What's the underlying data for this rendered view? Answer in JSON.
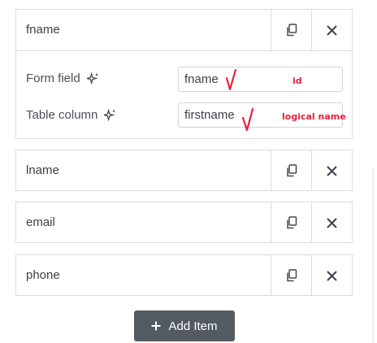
{
  "items": [
    {
      "name": "fname",
      "expanded": true,
      "form_field_label": "Form field",
      "form_field_value": "fname",
      "table_column_label": "Table column",
      "table_column_value": "firstname"
    },
    {
      "name": "lname"
    },
    {
      "name": "email"
    },
    {
      "name": "phone"
    }
  ],
  "annotations": {
    "id_note": "id",
    "logical_name_note": "logical name"
  },
  "add_button": {
    "label": "Add Item"
  },
  "icons": {
    "copy": "copy-icon",
    "close": "close-icon",
    "sparkle": "sparkle-icon",
    "plus": "plus-icon"
  },
  "colors": {
    "annotation": "#e8203a",
    "button_bg": "#535a62"
  }
}
